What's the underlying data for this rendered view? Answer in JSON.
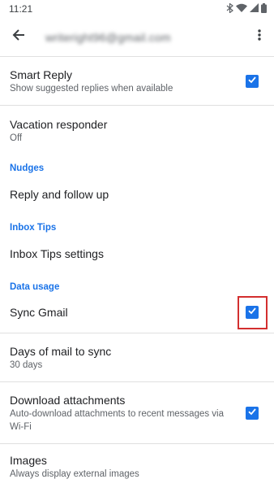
{
  "status_bar": {
    "time": "11:21"
  },
  "header": {
    "account_email": "writeright96@gmail.com"
  },
  "settings": {
    "smart_reply": {
      "title": "Smart Reply",
      "subtitle": "Show suggested replies when available",
      "checked": true
    },
    "vacation": {
      "title": "Vacation responder",
      "subtitle": "Off"
    },
    "nudges_header": "Nudges",
    "reply_follow_up": {
      "title": "Reply and follow up"
    },
    "inbox_tips_header": "Inbox Tips",
    "inbox_tips_settings": {
      "title": "Inbox Tips settings"
    },
    "data_usage_header": "Data usage",
    "sync_gmail": {
      "title": "Sync Gmail",
      "checked": true
    },
    "days_to_sync": {
      "title": "Days of mail to sync",
      "subtitle": "30 days"
    },
    "download_attachments": {
      "title": "Download attachments",
      "subtitle": "Auto-download attachments to recent messages via Wi-Fi",
      "checked": true
    },
    "images": {
      "title": "Images",
      "subtitle": "Always display external images"
    }
  },
  "colors": {
    "accent": "#1a73e8",
    "highlight": "#d32f2f"
  }
}
